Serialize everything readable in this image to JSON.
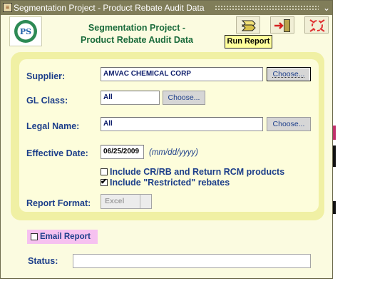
{
  "window": {
    "title": "Segmentation Project - Product Rebate Audit Data",
    "min_glyph": "⌄"
  },
  "header": {
    "logo_text": "PS",
    "title_line1": "Segmentation Project -",
    "title_line2": "Product Rebate Audit Data"
  },
  "toolbar": {
    "run_report_tooltip": "Run Report"
  },
  "form": {
    "supplier": {
      "label": "Supplier:",
      "value": "AMVAC CHEMICAL CORP",
      "button": "Choose..."
    },
    "gl_class": {
      "label": "GL Class:",
      "value": "All",
      "button": "Choose..."
    },
    "legal_name": {
      "label": "Legal Name:",
      "value": "All",
      "button": "Choose..."
    },
    "effective_date": {
      "label": "Effective Date:",
      "value": "06/25/2009",
      "hint": "(mm/dd/yyyy)"
    },
    "include_crrb": {
      "label": "Include CR/RB and Return RCM products",
      "checked": false
    },
    "include_restricted": {
      "label": "Include \"Restricted\" rebates",
      "checked": true
    },
    "report_format": {
      "label": "Report Format:",
      "value": "Excel"
    }
  },
  "footer": {
    "email_report": {
      "label": "Email Report",
      "checked": false
    },
    "status": {
      "label": "Status:",
      "value": ""
    }
  },
  "colors": {
    "titlebar": "#807d59",
    "window_bg": "#fbfbe0",
    "panel": "#f0f0a4",
    "label_blue": "#1c3e8a",
    "heading_green": "#1a6b3b",
    "email_highlight": "#f6c1f0",
    "tooltip": "#ffff9c"
  }
}
